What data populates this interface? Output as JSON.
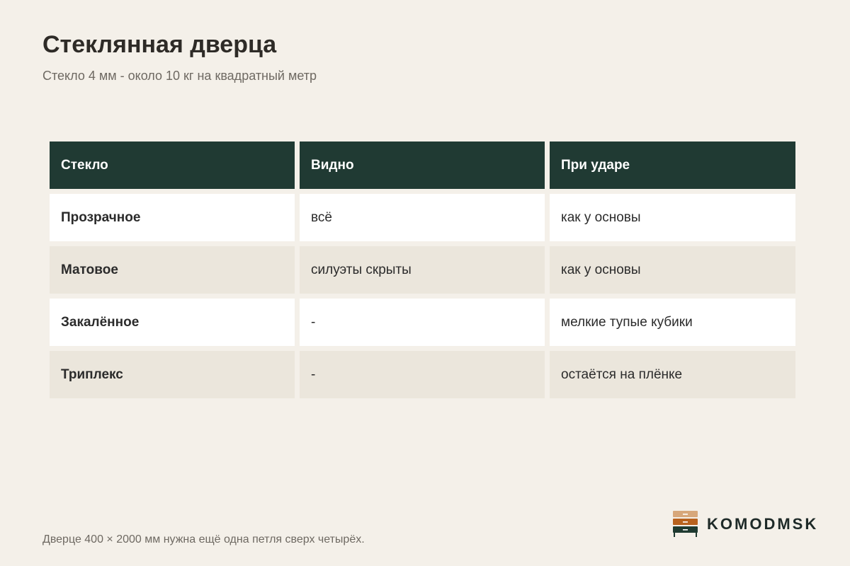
{
  "page": {
    "title": "Стеклянная дверца",
    "subtitle": "Стекло 4 мм - около 10 кг на квадратный метр",
    "footnote": "Дверце 400 × 2000 мм нужна ещё одна петля сверх четырёх."
  },
  "table": {
    "headers": [
      "Стекло",
      "Видно",
      "При ударе"
    ],
    "rows": [
      [
        "Прозрачное",
        "всё",
        "как у основы"
      ],
      [
        "Матовое",
        "силуэты скрыты",
        "как у основы"
      ],
      [
        "Закалённое",
        "-",
        "мелкие тупые кубики"
      ],
      [
        "Триплекс",
        "-",
        "остаётся на плёнке"
      ]
    ]
  },
  "logo": {
    "text": "KOMODMSK",
    "icon": "chest-of-drawers-icon",
    "colors": [
      "#d7a77a",
      "#b8621e",
      "#1f3a30"
    ]
  },
  "colors": {
    "background": "#f4f0e9",
    "header": "#203a33",
    "row_alt": "#ebe6dc"
  }
}
